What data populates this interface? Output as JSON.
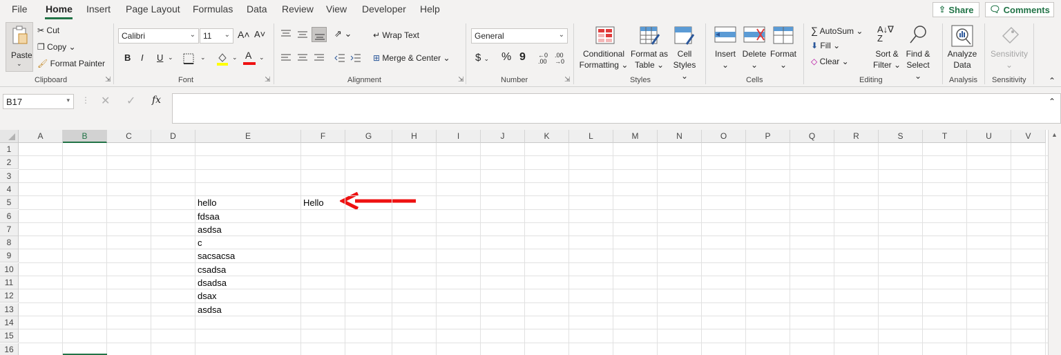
{
  "menu": {
    "tabs": [
      "File",
      "Home",
      "Insert",
      "Page Layout",
      "Formulas",
      "Data",
      "Review",
      "View",
      "Developer",
      "Help"
    ],
    "share_label": "Share",
    "comments_label": "Comments"
  },
  "ribbon": {
    "clipboard": {
      "paste": "Paste",
      "cut": "Cut",
      "copy": "Copy",
      "format_painter": "Format Painter",
      "label": "Clipboard"
    },
    "font": {
      "name": "Calibri",
      "size": "11",
      "bold": "B",
      "italic": "I",
      "underline": "U",
      "label": "Font"
    },
    "alignment": {
      "wrap_text": "Wrap Text",
      "merge_center": "Merge & Center",
      "label": "Alignment"
    },
    "number": {
      "format": "General",
      "currency": "$",
      "percent": "%",
      "comma": "9",
      "label": "Number"
    },
    "styles": {
      "conditional_1": "Conditional",
      "conditional_2": "Formatting",
      "format_table_1": "Format as",
      "format_table_2": "Table",
      "cell_styles_1": "Cell",
      "cell_styles_2": "Styles",
      "label": "Styles"
    },
    "cells": {
      "insert": "Insert",
      "delete": "Delete",
      "format": "Format",
      "label": "Cells"
    },
    "editing": {
      "autosum": "AutoSum",
      "fill": "Fill",
      "clear": "Clear",
      "sort_1": "Sort &",
      "sort_2": "Filter",
      "find_1": "Find &",
      "find_2": "Select",
      "label": "Editing"
    },
    "analysis": {
      "analyze_1": "Analyze",
      "analyze_2": "Data",
      "label": "Analysis"
    },
    "sensitivity": {
      "button": "Sensitivity",
      "label": "Sensitivity"
    }
  },
  "formula_bar": {
    "name_box": "B17",
    "fx": "fx",
    "value": ""
  },
  "grid": {
    "columns": [
      "A",
      "B",
      "C",
      "D",
      "E",
      "F",
      "G",
      "H",
      "I",
      "J",
      "K",
      "L",
      "M",
      "N",
      "O",
      "P",
      "Q",
      "R",
      "S",
      "T",
      "U",
      "V"
    ],
    "rows": [
      "1",
      "2",
      "3",
      "4",
      "5",
      "6",
      "7",
      "8",
      "9",
      "10",
      "11",
      "12",
      "13",
      "14",
      "15",
      "16"
    ],
    "selected_column": "B",
    "cells": {
      "E5": "hello",
      "F5": "Hello",
      "E6": "fdsaa",
      "E7": "asdsa",
      "E8": "c",
      "E9": "sacsacsa",
      "E10": "csadsa",
      "E11": "dsadsa",
      "E12": "dsax",
      "E13": "asdsa"
    }
  },
  "colors": {
    "accent": "#217346",
    "arrow": "#ee1111"
  }
}
